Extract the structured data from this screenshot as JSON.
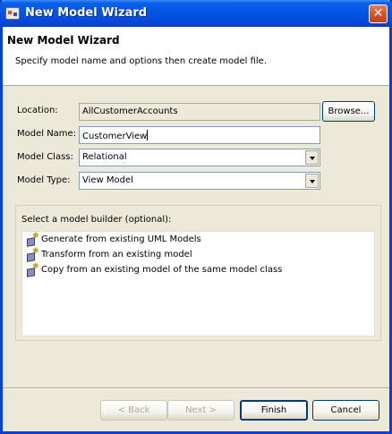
{
  "window": {
    "title": "New Model Wizard",
    "app_icon": "wizard-app-icon",
    "close_icon": "close-icon",
    "close_glyph": "✕"
  },
  "header": {
    "title": "New Model Wizard",
    "description": "Specify model name and options then create model file."
  },
  "form": {
    "location_label": "Location:",
    "location_value": "AllCustomerAccounts",
    "browse_label": "Browse...",
    "model_name_label": "Model Name:",
    "model_name_value": "CustomerView",
    "model_class_label": "Model Class:",
    "model_class_value": "Relational",
    "model_type_label": "Model Type:",
    "model_type_value": "View Model"
  },
  "builder": {
    "title": "Select a model builder (optional):",
    "items": [
      {
        "label": "Generate from existing UML Models",
        "icon": "model-builder-icon"
      },
      {
        "label": "Transform from an existing model",
        "icon": "model-builder-icon"
      },
      {
        "label": "Copy from an existing model of the same model class",
        "icon": "model-builder-icon"
      }
    ]
  },
  "buttons": {
    "back": "< Back",
    "next": "Next >",
    "finish": "Finish",
    "cancel": "Cancel"
  },
  "colors": {
    "titlebar": "#0454e3",
    "dialog_bg": "#ece9d8",
    "close_button": "#d9542f"
  }
}
